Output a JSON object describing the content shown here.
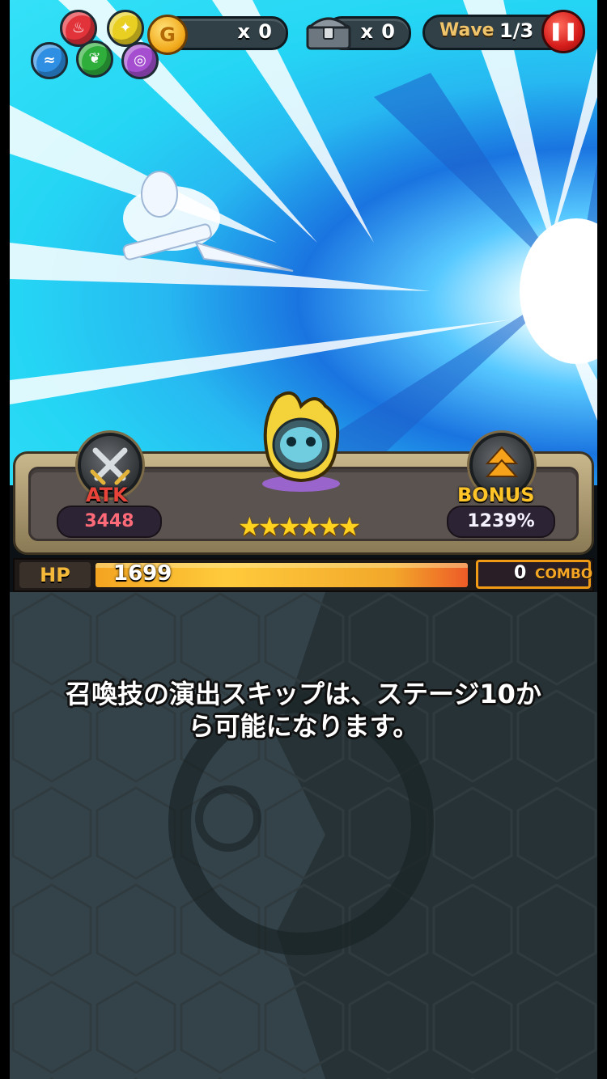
{
  "hud": {
    "elements": [
      {
        "name": "fire",
        "color": "#e2323a",
        "glyph": "♨"
      },
      {
        "name": "light",
        "color": "#e9cf22",
        "glyph": "✦"
      },
      {
        "name": "water",
        "color": "#2e8fe3",
        "glyph": "≈"
      },
      {
        "name": "wood",
        "color": "#2fae3c",
        "glyph": "❦"
      },
      {
        "name": "dark",
        "color": "#a54fd0",
        "glyph": "◎"
      }
    ],
    "coin_count": "x 0",
    "chest_count": "x 0",
    "wave_label": "Wave",
    "wave_value": "1/3",
    "pause_glyph": "❚❚"
  },
  "status": {
    "atk_label": "ATK",
    "atk_value": "3448",
    "bonus_label": "BONUS",
    "bonus_value": "1239%",
    "stars": "★★★★★★",
    "star_count": 6
  },
  "hp": {
    "label": "HP",
    "value": "1699",
    "fill_fraction": 1.0
  },
  "combo": {
    "count": "0",
    "label": "COMBO"
  },
  "notice": {
    "line1": "召喚技の演出スキップは、ステージ10か",
    "line2": "ら可能になります。"
  },
  "colors": {
    "atk_text": "#e8443a",
    "bonus_text": "#ffc427",
    "hp_fill": "#ffcb3c",
    "combo_border": "#f09a15"
  }
}
